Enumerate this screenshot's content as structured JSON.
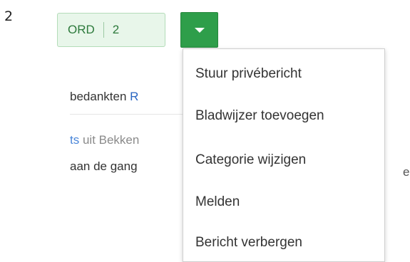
{
  "page_number": "2",
  "vote": {
    "label": "ORD",
    "count": "2"
  },
  "background": {
    "line1_text": "bedankten ",
    "line1_link": "R",
    "line2_link": "ts",
    "line2_text": " uit Bekken",
    "line3_text": "aan de gang",
    "line3_tail": "e"
  },
  "menu": {
    "items": [
      "Stuur privébericht",
      "Bladwijzer toevoegen",
      "Categorie wijzigen",
      "Melden",
      "Bericht verbergen"
    ]
  },
  "colors": {
    "accent_green": "#2e9e4a",
    "pill_bg": "#e8f6ea",
    "link_blue": "#2a66c2"
  }
}
